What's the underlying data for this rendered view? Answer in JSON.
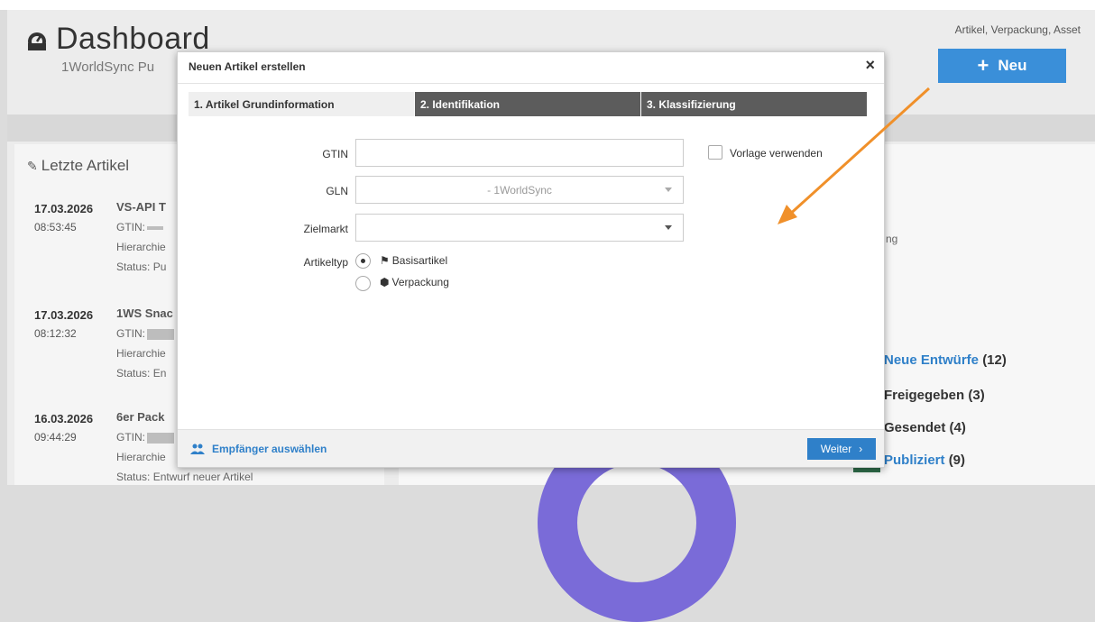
{
  "header": {
    "title": "Dashboard",
    "subtitle": "1WorldSync Pu",
    "new_caption": "Artikel, Verpackung, Asset",
    "new_button": "Neu"
  },
  "recent": {
    "title": "Letzte Artikel",
    "items": [
      {
        "date": "17.03.2026",
        "time": "08:53:45",
        "name": "VS-API T",
        "gtin": "GTIN:",
        "hier": "Hierarchie",
        "status": "Status: Pu"
      },
      {
        "date": "17.03.2026",
        "time": "08:12:32",
        "name": "1WS Snac",
        "gtin": "GTIN:",
        "hier": "Hierarchie",
        "status": "Status: En"
      },
      {
        "date": "16.03.2026",
        "time": "09:44:29",
        "name": "6er Pack",
        "gtin": "GTIN:",
        "hier": "Hierarchie",
        "status": "Status: Entwurf neuer Artikel"
      }
    ]
  },
  "right": {
    "fragment": "ng",
    "stats": [
      {
        "label": "Neue Entwürfe",
        "count": "(12)"
      },
      {
        "label": "Freigegeben",
        "count": "(3)"
      },
      {
        "label": "Gesendet",
        "count": "(4)"
      },
      {
        "label": "Publiziert",
        "count": "(9)"
      }
    ]
  },
  "modal": {
    "title": "Neuen Artikel erstellen",
    "close": "×",
    "tabs": [
      "1. Artikel Grundinformation",
      "2. Identifikation",
      "3. Klassifizierung"
    ],
    "gtin_label": "GTIN",
    "gtin_value": "",
    "gln_label": "GLN",
    "gln_value": "- 1WorldSync",
    "zielmarkt_label": "Zielmarkt",
    "zielmarkt_value": "",
    "vorlage_label": "Vorlage verwenden",
    "artikeltyp_label": "Artikeltyp",
    "types": [
      "Basisartikel",
      "Verpackung"
    ],
    "recipients_link": "Empfänger auswählen",
    "next_button": "Weiter"
  },
  "colors": {
    "accent": "#2f80c9",
    "arrow": "#f0902a",
    "tab_dark": "#5c5c5c"
  }
}
